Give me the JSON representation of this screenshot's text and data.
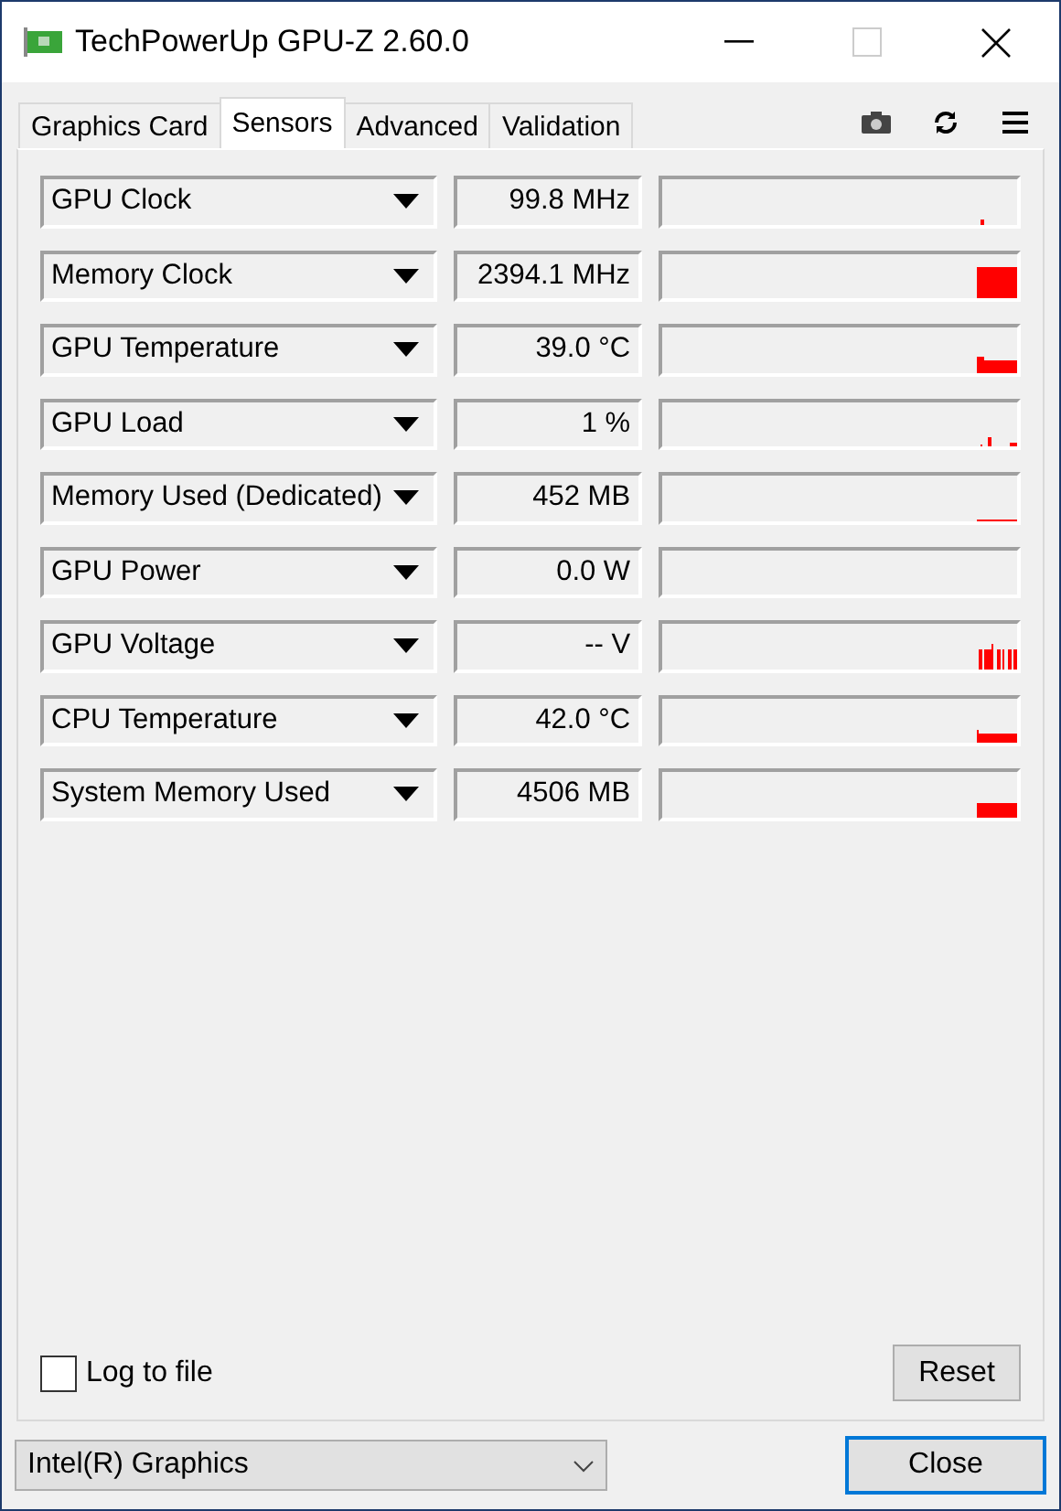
{
  "window": {
    "title": "TechPowerUp GPU-Z 2.60.0"
  },
  "tabs": [
    {
      "label": "Graphics Card",
      "selected": false
    },
    {
      "label": "Sensors",
      "selected": true
    },
    {
      "label": "Advanced",
      "selected": false
    },
    {
      "label": "Validation",
      "selected": false
    }
  ],
  "sensors": [
    {
      "name": "GPU Clock",
      "value": "99.8 MHz"
    },
    {
      "name": "Memory Clock",
      "value": "2394.1 MHz"
    },
    {
      "name": "GPU Temperature",
      "value": "39.0 °C"
    },
    {
      "name": "GPU Load",
      "value": "1 %"
    },
    {
      "name": "Memory Used (Dedicated)",
      "value": "452 MB"
    },
    {
      "name": "GPU Power",
      "value": "0.0 W"
    },
    {
      "name": "GPU Voltage",
      "value": "-- V"
    },
    {
      "name": "CPU Temperature",
      "value": "42.0 °C"
    },
    {
      "name": "System Memory Used",
      "value": "4506 MB"
    }
  ],
  "log_to_file": {
    "label": "Log to file",
    "checked": false
  },
  "reset_button": "Reset",
  "device_select": {
    "value": "Intel(R) Graphics"
  },
  "close_button": "Close"
}
